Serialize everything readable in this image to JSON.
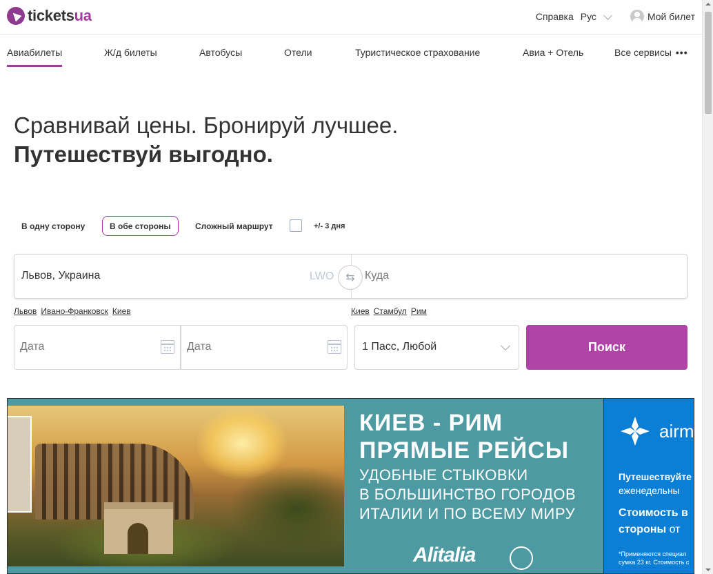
{
  "brand": {
    "logo_main": "tickets",
    "logo_accent": "ua",
    "accent_color": "#a43aa0",
    "button_color": "#b043a6"
  },
  "header": {
    "help": "Справка",
    "lang": "Рус",
    "my_ticket": "Мой билет"
  },
  "nav": {
    "items": [
      {
        "label": "Авиабилеты",
        "active": true
      },
      {
        "label": "Ж/д билеты"
      },
      {
        "label": "Автобусы"
      },
      {
        "label": "Отели"
      },
      {
        "label": "Туристическое страхование"
      },
      {
        "label": "Авиа + Отель"
      },
      {
        "label": "Все сервисы"
      }
    ]
  },
  "hero": {
    "line1": "Сравнивай цены. Бронируй лучшее.",
    "line2": "Путешествуй выгодно."
  },
  "search": {
    "trip_types": [
      "В одну сторону",
      "В обе стороны",
      "Сложный маршрут"
    ],
    "selected_trip_type": "В обе стороны",
    "flex_dates": "+/- 3 дня",
    "from_value": "Львов, Украина",
    "from_code": "LWO",
    "to_placeholder": "Куда",
    "from_quick": [
      "Львов",
      "Ивано-Франковск",
      "Киев"
    ],
    "to_quick": [
      "Киев",
      "Стамбул",
      "Рим"
    ],
    "date_depart_placeholder": "Дата",
    "date_return_placeholder": "Дата",
    "passengers": "1 Пасс, Любой",
    "search_button": "Поиск"
  },
  "banner": {
    "title1": "КИЕВ - РИМ",
    "title2": "ПРЯМЫЕ РЕЙСЫ",
    "line1": "УДОБНЫЕ СТЫКОВКИ",
    "line2": "В БОЛЬШИНСТВО ГОРОДОВ",
    "line3": "ИТАЛИИ И ПО ВСЕМУ МИРУ",
    "airline": "Alitalia",
    "right_brand": "airm",
    "right_line1": "Путешествуйте",
    "right_line2": "еженедельны",
    "right_line3": "Стоимость в",
    "right_line4_bold": "стороны",
    "right_line4_rest": " от",
    "right_note1": "*Применяются специал",
    "right_note2": "сумка 23 кг. Стоимость с"
  }
}
